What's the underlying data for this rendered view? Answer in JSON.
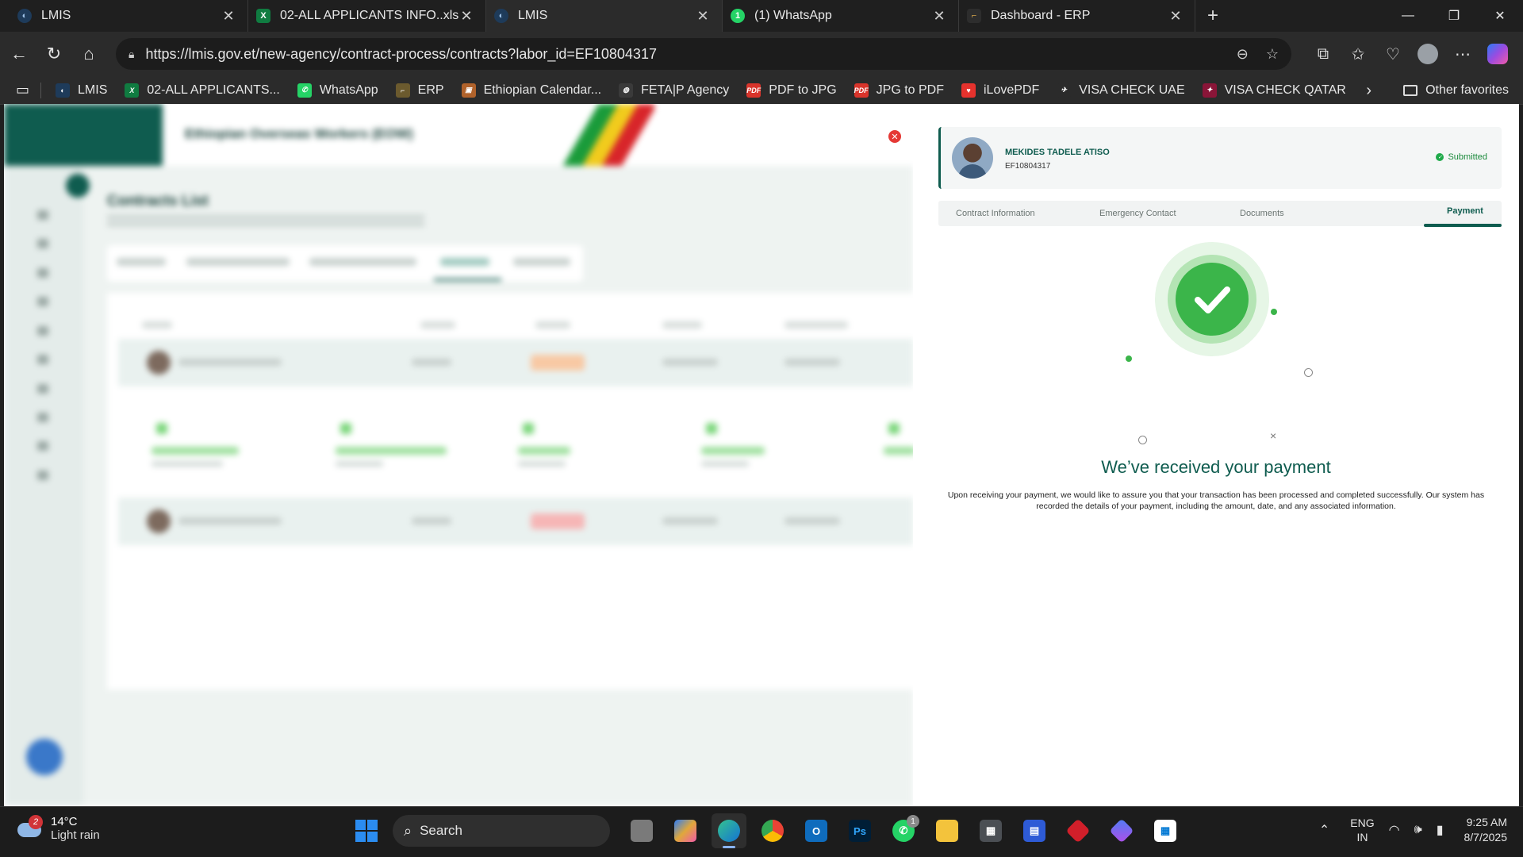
{
  "tabs": [
    {
      "title": "LMIS",
      "favicon": "lmis-icon",
      "active": false
    },
    {
      "title": "02-ALL APPLICANTS INFO..xlsx",
      "favicon": "excel-icon",
      "active": false
    },
    {
      "title": "LMIS",
      "favicon": "lmis-icon",
      "active": true
    },
    {
      "title": "(1) WhatsApp",
      "favicon": "whatsapp-icon",
      "active": false
    },
    {
      "title": "Dashboard - ERP",
      "favicon": "erp-icon",
      "active": false
    }
  ],
  "address_bar": {
    "url": "https://lmis.gov.et/new-agency/contract-process/contracts?labor_id=EF10804317"
  },
  "bookmarks": [
    {
      "label": "LMIS",
      "icon": "lmis-icon",
      "color": "#1e3b5a"
    },
    {
      "label": "02-ALL APPLICANTS...",
      "icon": "excel-icon",
      "color": "#107c41"
    },
    {
      "label": "WhatsApp",
      "icon": "whatsapp-icon",
      "color": "#25d366"
    },
    {
      "label": "ERP",
      "icon": "erp-icon",
      "color": "#6b5a2e"
    },
    {
      "label": "Ethiopian Calendar...",
      "icon": "calendar-icon",
      "color": "#b0622b"
    },
    {
      "label": "FETA|P Agency",
      "icon": "globe-icon",
      "color": "#3a3a3a"
    },
    {
      "label": "PDF to JPG",
      "icon": "pdf-icon",
      "color": "#d9342b"
    },
    {
      "label": "JPG to PDF",
      "icon": "pdf-icon",
      "color": "#d9342b"
    },
    {
      "label": "iLovePDF",
      "icon": "heart-icon",
      "color": "#e5322d"
    },
    {
      "label": "VISA CHECK UAE",
      "icon": "uae-icon",
      "color": "#2b2b2b"
    },
    {
      "label": "VISA CHECK QATAR",
      "icon": "qatar-icon",
      "color": "#8a1538"
    }
  ],
  "bookmarks_other": "Other favorites",
  "background_page": {
    "org_name": "Ethiopian Overseas Workers (EOW)",
    "title": "Contracts List"
  },
  "panel": {
    "applicant_name": "MEKIDES TADELE ATISO",
    "labor_id": "EF10804317",
    "status": "Submitted",
    "tabs": [
      "Contract Information",
      "Emergency Contact",
      "Documents",
      "Payment"
    ],
    "active_tab": "Payment",
    "success_heading": "We’ve received your payment",
    "success_message": "Upon receiving your payment, we would like to assure you that your transaction has been processed and completed successfully. Our system has recorded the details of your payment, including the amount, date, and any associated information.",
    "accent_color": "#0f5c4f",
    "success_color": "#3bb54a"
  },
  "taskbar": {
    "weather_temp": "14°C",
    "weather_cond": "Light rain",
    "weather_badge": "2",
    "search_label": "Search",
    "whatsapp_badge": "1",
    "lang_line1": "ENG",
    "lang_line2": "IN",
    "time": "9:25 AM",
    "date": "8/7/2025"
  }
}
